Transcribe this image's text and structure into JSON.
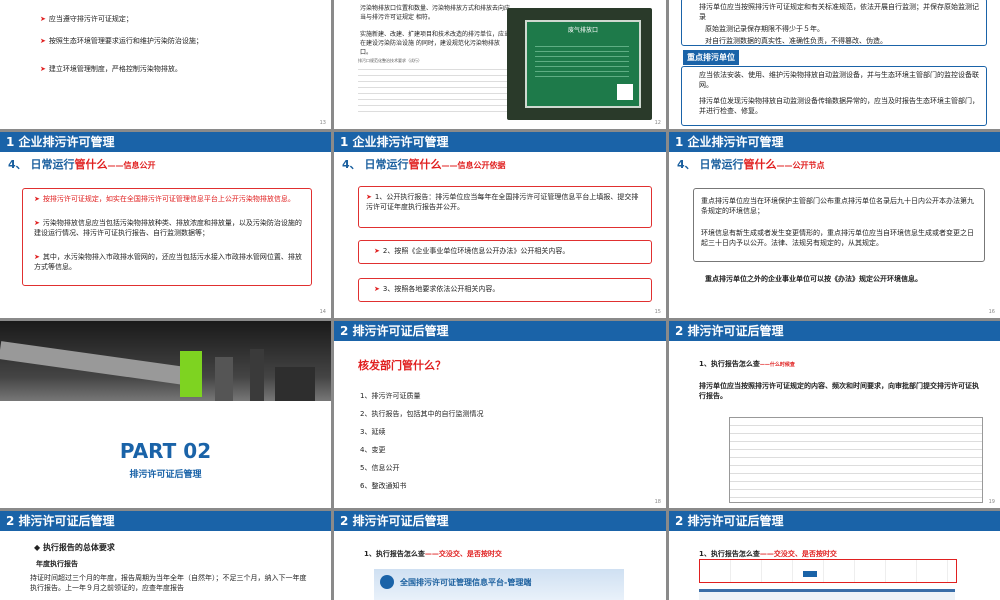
{
  "slides": [
    {
      "id": 1,
      "lines": [
        "应当遵守排污许可证规定；",
        "按照生态环境管理要求运行和维护污染防治设施；",
        "建立环境管理制度，严格控制污染物排放。"
      ],
      "page": "13"
    },
    {
      "id": 2,
      "lines": [
        "污染物排放口位置和数量、污染物排放方式和排放去向应当与排污许可证规定 相符。",
        "实施新建、改建、扩建项目和技术改造的排污单位，应当在建设污染防治设施 的同时，建设规范化污染物排放口。"
      ],
      "doc_title": "排污口规范化整治技术要求（试行）",
      "photo_sign": "废气排放口",
      "page": "12"
    },
    {
      "id": 3,
      "lines": [
        "排污单位应当按照排污许可证规定和有关标准规范，依法开展自行监测；并保存原始监测记录",
        "原始监测记录保存期限不得少于５年。",
        "对自行监测数据的真实性、准确性负责，不得篡改、伪造。"
      ],
      "section": "重点排污单位",
      "lines2": [
        "应当依法安装、使用、维护污染物排放自动监测设备，并与生态环境主管部门的监控设备联网。",
        "排污单位发现污染物排放自动监测设备传输数据异常的，应当及时报告生态环境主管部门，并进行检查、修复。"
      ]
    },
    {
      "id": 4,
      "header": "1  企业排污许可管理",
      "sub": "4、  日常运行",
      "sub_red": "管什么",
      "sub_small": "——信息公开",
      "items": [
        "按排污许可证规定，如实在全国排污许可证管理信息平台上公开污染物排放信息。",
        "污染物排放信息应当包括污染物排放种类、排放浓度和排放量，以及污染防治设施的建设运行情况、排污许可证执行报告、自行监测数据等；",
        "其中，水污染物排入市政排水管网的，还应当包括污水接入市政排水管网位置、排放方式等信息。"
      ],
      "page": "14"
    },
    {
      "id": 5,
      "header": "1  企业排污许可管理",
      "sub": "4、  日常运行",
      "sub_red": "管什么",
      "sub_small": "——信息公开依据",
      "items": [
        "1、公开执行报告：排污单位应当每年在全国排污许可证管理信息平台上填报、提交排污许可证年度执行报告并公开。",
        "2、按照《企业事业单位环境信息公开办法》公开相关内容。",
        "3、按照各地要求依法公开相关内容。"
      ],
      "page": "15"
    },
    {
      "id": 6,
      "header": "1  企业排污许可管理",
      "sub": "4、  日常运行",
      "sub_red": "管什么",
      "sub_small": "——公开节点",
      "items": [
        "重点排污单位应当在环境保护主管部门公布重点排污单位名录后九十日内公开本办法第九条规定的环境信息；",
        "环境信息有新生成或者发生变更情形的，重点排污单位应当自环境信息生成或者变更之日起三十日内予以公开。法律、法规另有规定的，从其规定。"
      ],
      "note": "重点排污单位之外的企业事业单位可以按《办法》规定公开环境信息。",
      "page": "16"
    },
    {
      "id": 7,
      "title": "PART 02",
      "subtitle": "排污许可证后管理"
    },
    {
      "id": 8,
      "header": "2    排污许可证后管理",
      "q": "核发部门管什么？",
      "items": [
        "1、排污许可证质量",
        "2、执行报告，包括其中的自行监测情况",
        "3、延续",
        "4、变更",
        "5、信息公开",
        "6、整改通知书"
      ],
      "page": "18"
    },
    {
      "id": 9,
      "header": "2    排污许可证后管理",
      "sub": "1、执行报告怎么查",
      "sub_small": "——什么时候查",
      "text": "排污单位应当按照排污许可证规定的内容、频次和时间要求，向审批部门提交排污许可证执行报告。",
      "page": "19"
    },
    {
      "id": 10,
      "header": "2  排污许可证后管理",
      "h": "◆ 执行报告的总体要求",
      "h2": "年度执行报告",
      "text": "持证时间超过三个月的年度，报告周期为当年全年（自然年）；不足三个月，纳入下一年度执行报告。上一年９月之前领证的，应查年度报告"
    },
    {
      "id": 11,
      "header": "2    排污许可证后管理",
      "sub": "1、执行报告怎么查",
      "sub_small": "——交没交、是否按时交",
      "platform": "全国排污许可证管理信息平台-管理端"
    },
    {
      "id": 12,
      "header": "2  排污许可证后管理",
      "sub": "1、执行报告怎么查",
      "sub_small": "——交没交、是否按时交"
    }
  ]
}
